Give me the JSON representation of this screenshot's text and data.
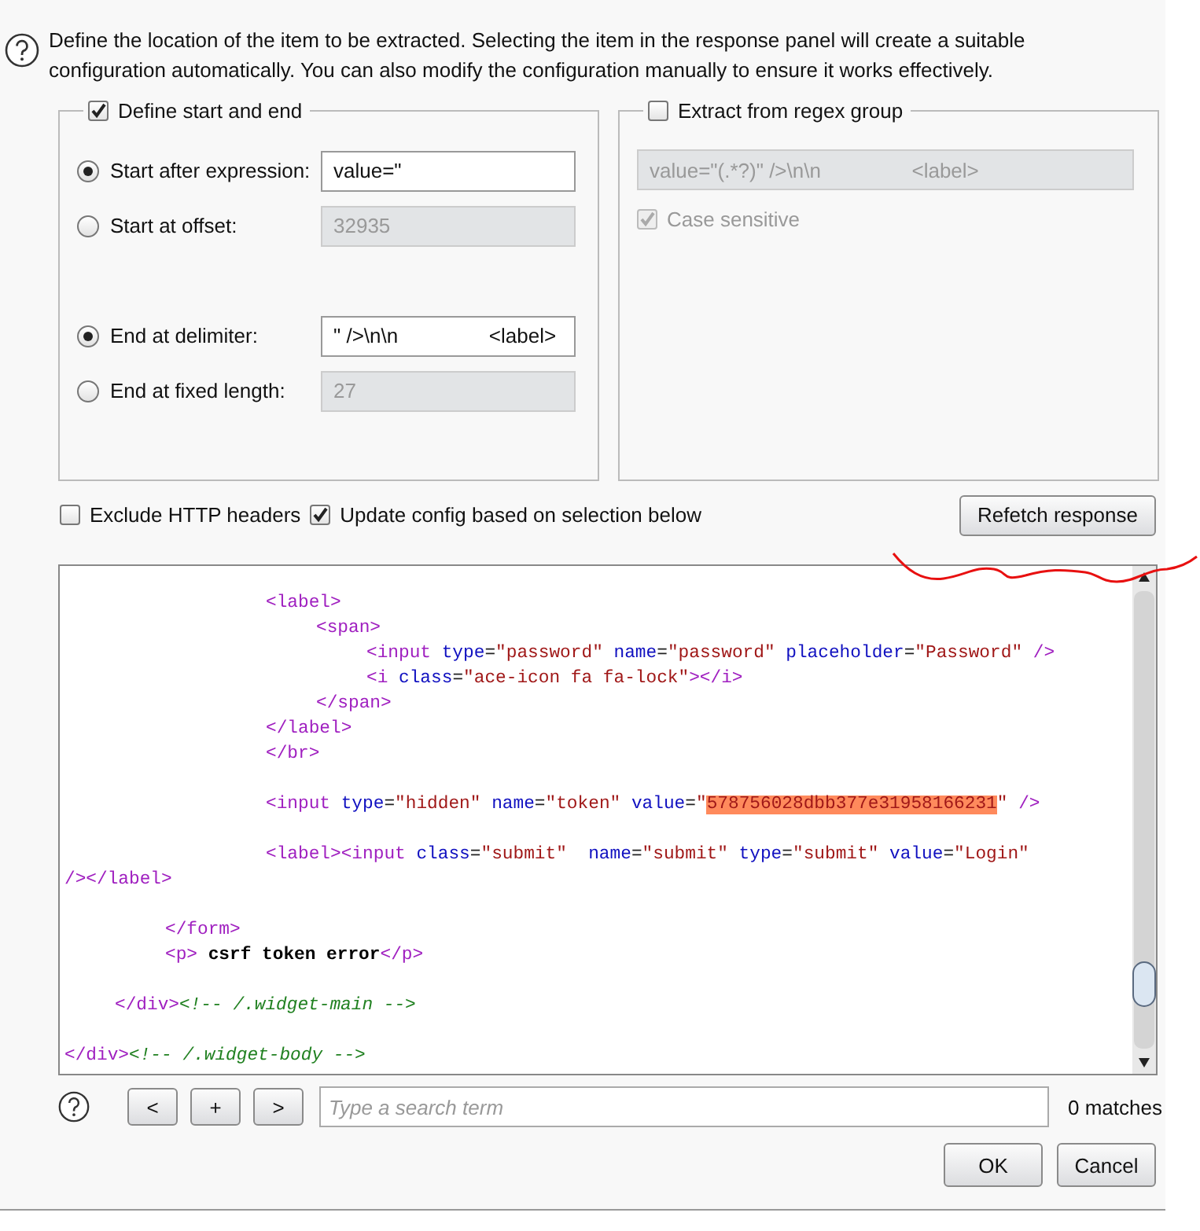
{
  "help_text": "Define the location of the item to be extracted. Selecting the item in the response panel will create a suitable configuration automatically. You can also modify the configuration manually to ensure it works effectively.",
  "start_end_group": {
    "label": "Define start and end",
    "checked": true,
    "start_options": [
      {
        "label": "Start after expression:",
        "selected": true,
        "value": "value=\"",
        "disabled": false
      },
      {
        "label": "Start at offset:",
        "selected": false,
        "value": "32935",
        "disabled": true
      }
    ],
    "end_options": [
      {
        "label": "End at delimiter:",
        "selected": true,
        "value": "\" />\\n\\n                <label>",
        "disabled": false
      },
      {
        "label": "End at fixed length:",
        "selected": false,
        "value": "27",
        "disabled": true
      }
    ]
  },
  "regex_group": {
    "label": "Extract from regex group",
    "checked": false,
    "field": {
      "value": "value=\"(.*?)\" />\\n\\n                <label>",
      "disabled": true
    },
    "case_sensitive": {
      "label": "Case sensitive",
      "checked": true,
      "disabled": true
    }
  },
  "options": [
    {
      "label": "Exclude HTTP headers",
      "checked": false
    },
    {
      "label": "Update config based on selection below",
      "checked": true
    }
  ],
  "refetch_button": "Refetch response",
  "response_blocks": [
    [
      [
        {
          "kind": "tag",
          "text": "\t\t\t\t<label>"
        }
      ],
      [
        {
          "kind": "tag",
          "text": "\t\t\t\t\t<span>"
        }
      ],
      [
        {
          "kind": "tag",
          "text": "\t\t\t\t\t\t<input"
        },
        {
          "kind": "attr",
          "text": " type"
        },
        {
          "kind": "punct",
          "text": "="
        },
        {
          "kind": "str",
          "text": "\"password\""
        },
        {
          "kind": "attr",
          "text": " name"
        },
        {
          "kind": "punct",
          "text": "="
        },
        {
          "kind": "str",
          "text": "\"password\""
        },
        {
          "kind": "attr",
          "text": " placeholder"
        },
        {
          "kind": "punct",
          "text": "="
        },
        {
          "kind": "str",
          "text": "\"Password\""
        },
        {
          "kind": "tag",
          "text": " />"
        }
      ],
      [
        {
          "kind": "tag",
          "text": "\t\t\t\t\t\t<i"
        },
        {
          "kind": "attr",
          "text": " class"
        },
        {
          "kind": "punct",
          "text": "="
        },
        {
          "kind": "str",
          "text": "\"ace-icon fa fa-lock\""
        },
        {
          "kind": "tag",
          "text": "></i>"
        }
      ],
      [
        {
          "kind": "tag",
          "text": "\t\t\t\t\t</span>"
        }
      ],
      [
        {
          "kind": "tag",
          "text": "\t\t\t\t</label>"
        }
      ],
      [
        {
          "kind": "tag",
          "text": "\t\t\t\t</br>"
        }
      ]
    ],
    [
      [
        {
          "kind": "tag",
          "text": "\t\t\t\t<input"
        },
        {
          "kind": "attr",
          "text": " type"
        },
        {
          "kind": "punct",
          "text": "="
        },
        {
          "kind": "str",
          "text": "\"hidden\""
        },
        {
          "kind": "attr",
          "text": " name"
        },
        {
          "kind": "punct",
          "text": "="
        },
        {
          "kind": "str",
          "text": "\"token\""
        },
        {
          "kind": "attr",
          "text": " value"
        },
        {
          "kind": "punct",
          "text": "="
        },
        {
          "kind": "str",
          "text": "\""
        },
        {
          "kind": "highlight",
          "text": "578756028dbb377e31958166231"
        },
        {
          "kind": "str",
          "text": "\""
        },
        {
          "kind": "tag",
          "text": " />"
        }
      ]
    ],
    [
      [
        {
          "kind": "tag",
          "text": "\t\t\t\t<label><input"
        },
        {
          "kind": "attr",
          "text": " class"
        },
        {
          "kind": "punct",
          "text": "="
        },
        {
          "kind": "str",
          "text": "\"submit\""
        },
        {
          "kind": "attr",
          "text": "  name"
        },
        {
          "kind": "punct",
          "text": "="
        },
        {
          "kind": "str",
          "text": "\"submit\""
        },
        {
          "kind": "attr",
          "text": " type"
        },
        {
          "kind": "punct",
          "text": "="
        },
        {
          "kind": "str",
          "text": "\"submit\""
        },
        {
          "kind": "attr",
          "text": " value"
        },
        {
          "kind": "punct",
          "text": "="
        },
        {
          "kind": "str",
          "text": "\"Login\""
        }
      ],
      [
        {
          "kind": "tag",
          "text": "/></label>"
        }
      ]
    ],
    [
      [
        {
          "kind": "tag",
          "text": "\t\t</form>"
        }
      ],
      [
        {
          "kind": "tag",
          "text": "\t\t<p>"
        },
        {
          "kind": "bold",
          "text": " csrf token error"
        },
        {
          "kind": "tag",
          "text": "</p>"
        }
      ]
    ],
    [
      [
        {
          "kind": "tag",
          "text": "\t</div>"
        },
        {
          "kind": "comment",
          "text": "<!-- /.widget-main -->"
        }
      ]
    ],
    [
      [
        {
          "kind": "tag",
          "text": "</div>"
        },
        {
          "kind": "comment",
          "text": "<!-- /.widget-body -->"
        }
      ]
    ]
  ],
  "search": {
    "buttons": [
      "<",
      "+",
      ">"
    ],
    "placeholder": "Type a search term",
    "matches": "0 matches"
  },
  "buttons": [
    "OK",
    "Cancel"
  ]
}
